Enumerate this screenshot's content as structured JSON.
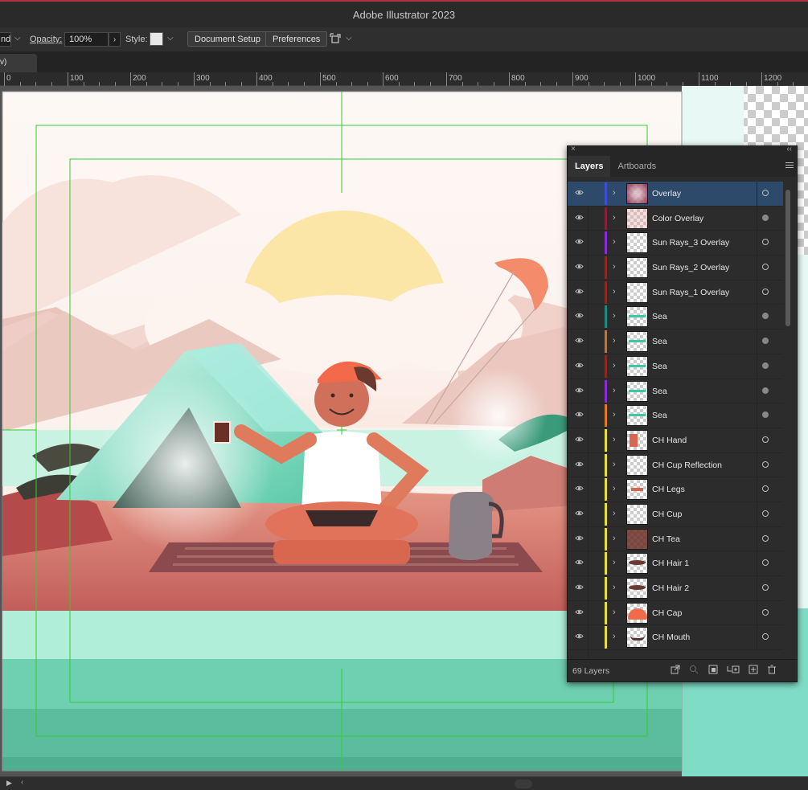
{
  "app": {
    "title": "Adobe Illustrator 2023"
  },
  "control_bar": {
    "blend_mode_fragment": "nd",
    "opacity_label": "Opacity:",
    "opacity_value": "100%",
    "style_label": "Style:",
    "document_setup": "Document Setup",
    "preferences": "Preferences"
  },
  "doc_tab": {
    "label": "v)"
  },
  "ruler": {
    "labels": [
      "0",
      "100",
      "200",
      "300",
      "400",
      "500",
      "600",
      "700",
      "800",
      "900",
      "1000",
      "1100",
      "1200"
    ]
  },
  "layers_panel": {
    "tabs": [
      "Layers",
      "Artboards"
    ],
    "count_label": "69 Layers",
    "layers": [
      {
        "name": "Overlay",
        "color": "#3b4fd6",
        "selected": true,
        "target": "hollow",
        "thumb": "overlay"
      },
      {
        "name": "Color Overlay",
        "color": "#8a1f3a",
        "selected": false,
        "target": "filled",
        "thumb": "color"
      },
      {
        "name": "Sun Rays_3 Overlay",
        "color": "#8a2bd6",
        "selected": false,
        "target": "hollow",
        "thumb": "blank"
      },
      {
        "name": "Sun Rays_2 Overlay",
        "color": "#8a2a1f",
        "selected": false,
        "target": "hollow",
        "thumb": "blank"
      },
      {
        "name": "Sun Rays_1 Overlay",
        "color": "#8a2a1f",
        "selected": false,
        "target": "hollow",
        "thumb": "blank"
      },
      {
        "name": "Sea",
        "color": "#1a8a80",
        "selected": false,
        "target": "filled",
        "thumb": "sea"
      },
      {
        "name": "Sea",
        "color": "#b07a50",
        "selected": false,
        "target": "filled",
        "thumb": "sea"
      },
      {
        "name": "Sea",
        "color": "#8a2a1f",
        "selected": false,
        "target": "filled",
        "thumb": "sea"
      },
      {
        "name": "Sea",
        "color": "#8a2bd6",
        "selected": false,
        "target": "filled",
        "thumb": "sea"
      },
      {
        "name": "Sea",
        "color": "#e07a20",
        "selected": false,
        "target": "filled",
        "thumb": "sea"
      },
      {
        "name": "CH Hand",
        "color": "#e8e040",
        "selected": false,
        "target": "hollow",
        "thumb": "hand"
      },
      {
        "name": "CH Cup Reflection",
        "color": "#e8e040",
        "selected": false,
        "target": "hollow",
        "thumb": "blank"
      },
      {
        "name": "CH Legs",
        "color": "#e8e040",
        "selected": false,
        "target": "hollow",
        "thumb": "legs"
      },
      {
        "name": "CH Cup",
        "color": "#e8e040",
        "selected": false,
        "target": "hollow",
        "thumb": "blank"
      },
      {
        "name": "CH Tea",
        "color": "#e8e040",
        "selected": false,
        "target": "hollow",
        "thumb": "tea"
      },
      {
        "name": "CH Hair 1",
        "color": "#e8e040",
        "selected": false,
        "target": "hollow",
        "thumb": "hair"
      },
      {
        "name": "CH Hair 2",
        "color": "#e8e040",
        "selected": false,
        "target": "hollow",
        "thumb": "hair"
      },
      {
        "name": "CH Cap",
        "color": "#e8e040",
        "selected": false,
        "target": "hollow",
        "thumb": "cap"
      },
      {
        "name": "CH Mouth",
        "color": "#e8e040",
        "selected": false,
        "target": "hollow",
        "thumb": "mouth"
      }
    ]
  }
}
